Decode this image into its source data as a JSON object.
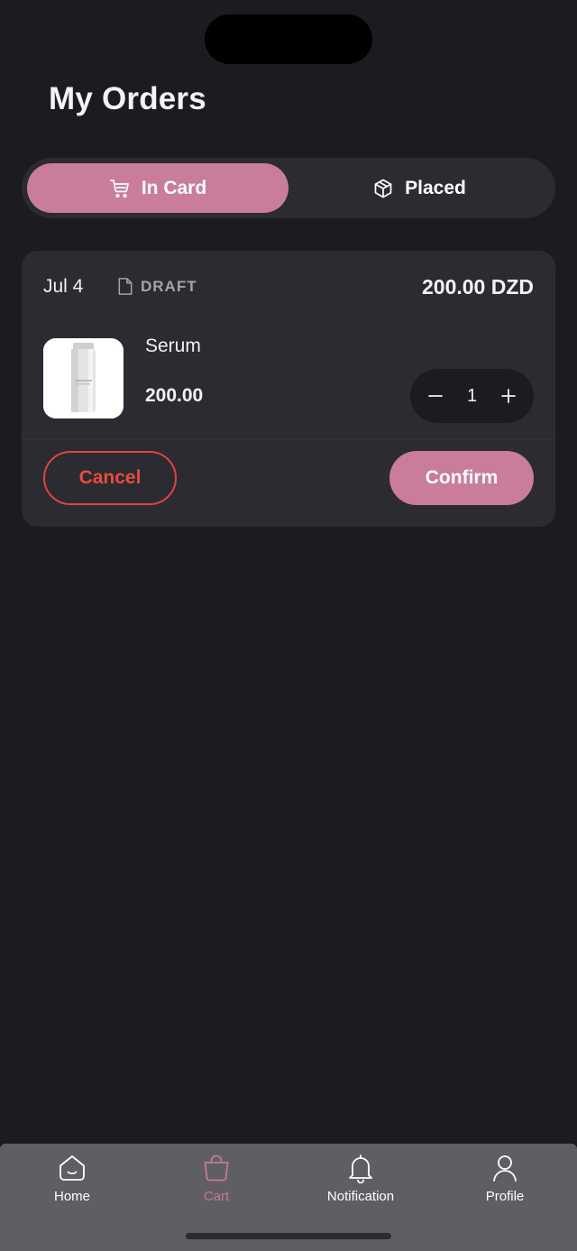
{
  "header": {
    "title": "My Orders"
  },
  "tabs": {
    "in_card_label": "In Card",
    "placed_label": "Placed",
    "active": "in_card"
  },
  "order": {
    "date": "Jul 4",
    "status": "DRAFT",
    "total": "200.00 DZD",
    "item": {
      "name": "Serum",
      "price": "200.00",
      "quantity": "1"
    },
    "cancel_label": "Cancel",
    "confirm_label": "Confirm"
  },
  "bottom_nav": [
    {
      "label": "Home",
      "icon": "home-icon"
    },
    {
      "label": "Cart",
      "icon": "shopping-bag-icon",
      "active": true
    },
    {
      "label": "Notification",
      "icon": "bell-icon"
    },
    {
      "label": "Profile",
      "icon": "user-icon"
    }
  ],
  "colors": {
    "background": "#1c1c20",
    "card": "#2b2b31",
    "accent": "#c97d9a",
    "danger": "#e0433b",
    "tabbar": "#5f5e64"
  }
}
